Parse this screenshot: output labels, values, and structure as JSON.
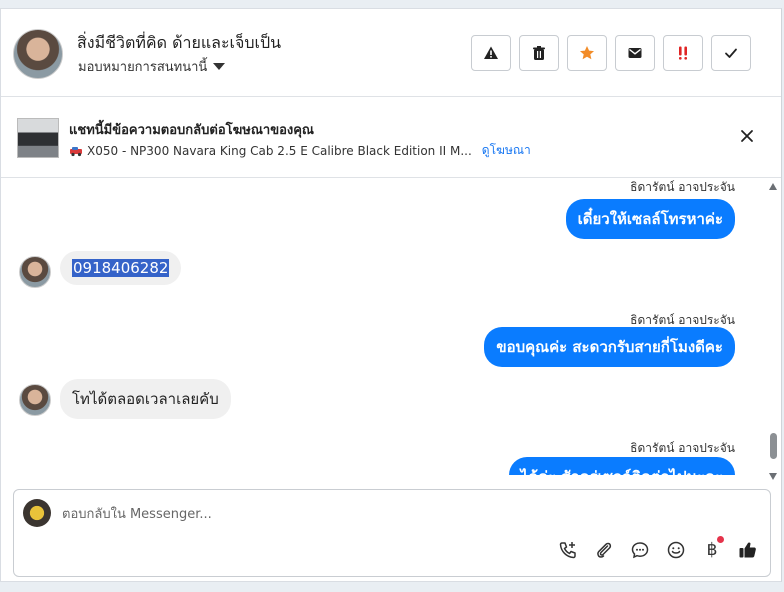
{
  "header": {
    "contact_name": "สิ่งมีชีวิตที่คิด ด้ายและเจ็บเป็น",
    "assign_label": "มอบหมายการสนทนานี้",
    "actions": [
      {
        "icon": "warning-icon",
        "color": "#222222"
      },
      {
        "icon": "trash-icon",
        "color": "#222222"
      },
      {
        "icon": "star-icon",
        "color": "#f28c28"
      },
      {
        "icon": "mail-icon",
        "color": "#222222"
      },
      {
        "icon": "double-exclamation-icon",
        "color": "#e02424"
      },
      {
        "icon": "check-icon",
        "color": "#222222"
      }
    ]
  },
  "ad": {
    "title": "แชทนี้มีข้อความตอบกลับต่อโฆษณาของคุณ",
    "vehicle": "X050 - NP300 Navara King Cab 2.5 E Calibre Black Edition II M...",
    "view_ad": "ดูโฆษณา"
  },
  "messages": [
    {
      "sender": "ธิดารัตน์ อาจประจัน",
      "text": "เดี๋ยวให้เซลล์โทรหาค่ะ"
    },
    {
      "text": "0918406282"
    },
    {
      "sender": "ธิดารัตน์ อาจประจัน",
      "text": "ขอบคุณค่ะ สะดวกรับสายกี่โมงดีคะ"
    },
    {
      "text": "โทได้ตลอดเวลาเลยคับ"
    },
    {
      "sender": "ธิดารัตน์ อาจประจัน",
      "text": "ได้ค่ะ สักครู่เซลล์ติดต่อไปนะคะ"
    }
  ],
  "composer": {
    "placeholder": "ตอบกลับใน Messenger...",
    "tools": [
      "call-add-icon",
      "paperclip-icon",
      "chat-bubble-icon",
      "emoji-icon",
      "baht-icon",
      "thumbs-up-icon"
    ],
    "baht_symbol": "฿"
  },
  "colors": {
    "accent": "#0a7cff",
    "link": "#1877f2",
    "star": "#f28c28",
    "alert": "#e02424"
  }
}
